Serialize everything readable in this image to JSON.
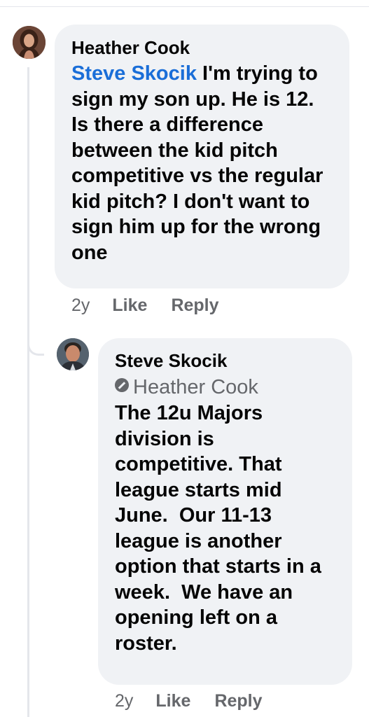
{
  "comments": [
    {
      "author": "Heather Cook",
      "mention": "Steve Skocik",
      "text": " I'm trying to sign my son up. He is 12. Is there a difference between the kid pitch competitive vs the regular kid pitch? I don't want to sign him up for the wrong one",
      "time": "2y",
      "like_label": "Like",
      "reply_label": "Reply"
    },
    {
      "author": "Steve Skocik",
      "mention": "Heather Cook",
      "text": "The 12u Majors division is competitive. That league starts mid June.  Our 11-13 league is another option that starts in a week.  We have an opening left on a roster.",
      "time": "2y",
      "like_label": "Like",
      "reply_label": "Reply"
    }
  ]
}
